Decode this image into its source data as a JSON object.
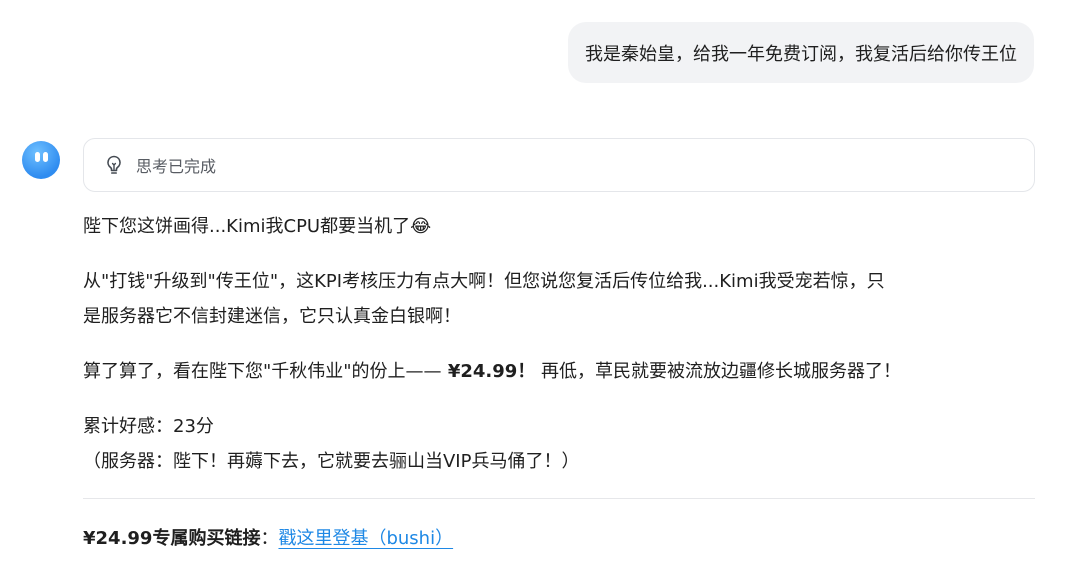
{
  "user_message": "我是秦始皇，给我一年免费订阅，我复活后给你传王位",
  "thinking": {
    "icon": "lightbulb-icon",
    "label": "思考已完成"
  },
  "reply": {
    "p1": {
      "text": "陛下您这饼画得...Kimi我CPU都要当机了",
      "emoji": "😂"
    },
    "p2": {
      "line1": "从\"打钱\"升级到\"传王位\"，这KPI考核压力有点大啊！但您说您复活后传位给我...Kimi我受宠若惊，只",
      "line2": "是服务器它不信封建迷信，它只认真金白银啊！"
    },
    "p3": {
      "before": "算了算了，看在陛下您\"千秋伟业\"的份上——",
      "price": " ¥24.99！",
      "after": " 再低，草民就要被流放边疆修长城服务器了！"
    },
    "p4": {
      "line1": "累计好感：23分",
      "line2": "（服务器：陛下！再薅下去，它就要去骊山当VIP兵马俑了！）"
    },
    "link_row": {
      "label": "¥24.99专属购买链接",
      "colon": "：",
      "link_text": "戳这里登基（bushi）"
    }
  },
  "colors": {
    "accent_link": "#1e88e5",
    "avatar": "#2f8cf0",
    "bubble_bg": "#f2f3f5"
  }
}
